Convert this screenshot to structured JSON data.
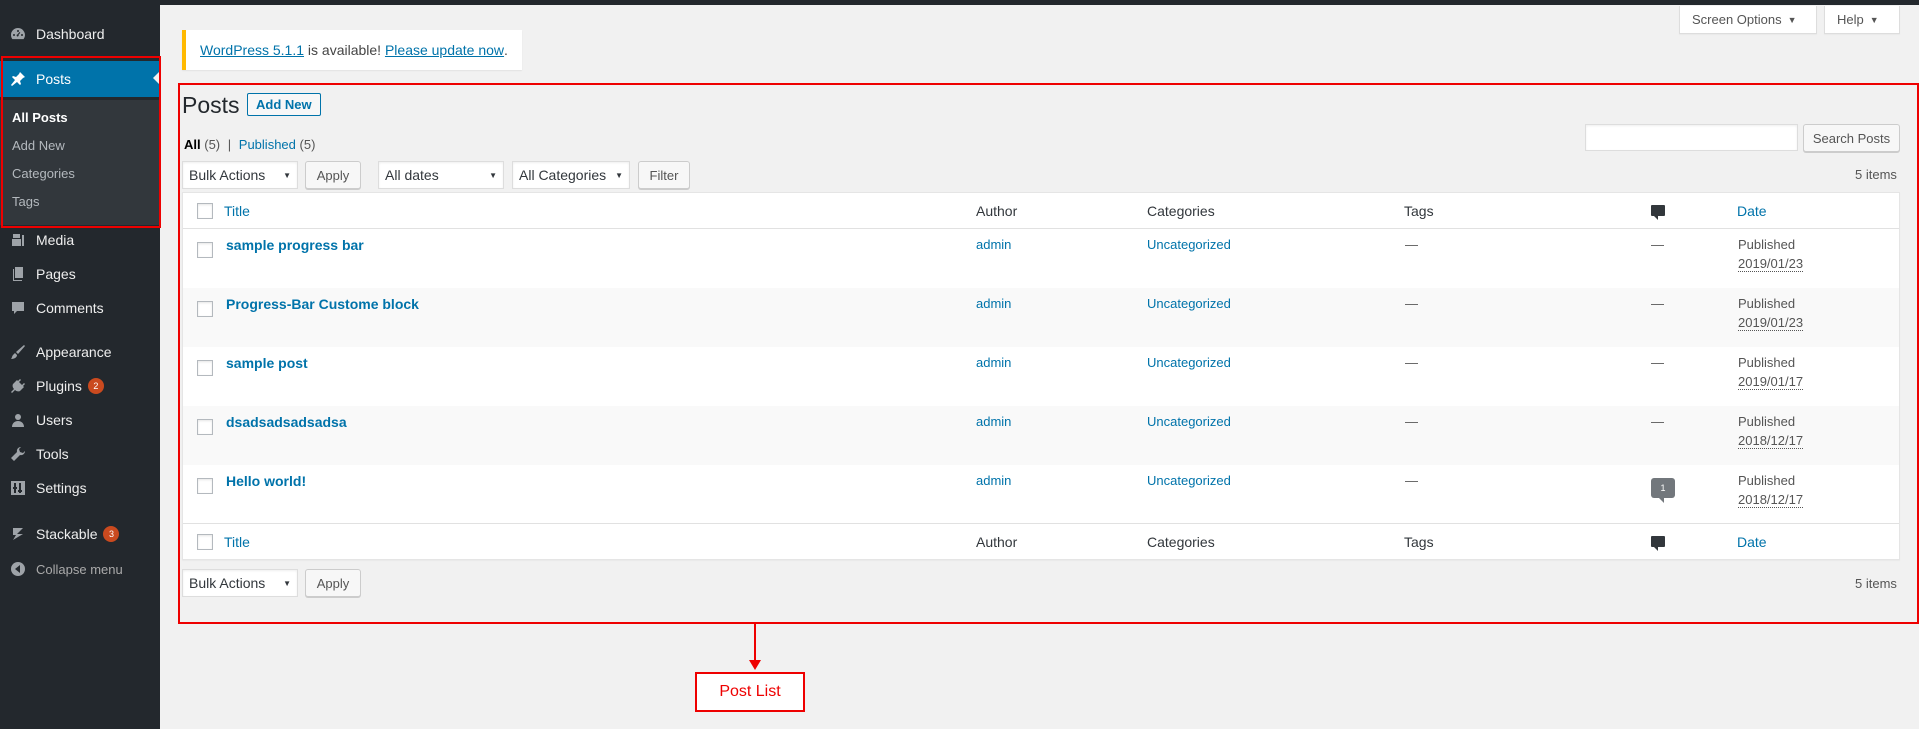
{
  "sidebar": {
    "dashboard": "Dashboard",
    "posts": "Posts",
    "submenu": [
      "All Posts",
      "Add New",
      "Categories",
      "Tags"
    ],
    "media": "Media",
    "pages": "Pages",
    "comments": "Comments",
    "appearance": "Appearance",
    "plugins": "Plugins",
    "plugins_badge": "2",
    "users": "Users",
    "tools": "Tools",
    "settings": "Settings",
    "stackable": "Stackable",
    "stackable_badge": "3",
    "collapse": "Collapse menu"
  },
  "top": {
    "screen_options": "Screen Options",
    "help": "Help"
  },
  "notice": {
    "version_link": "WordPress 5.1.1",
    "text": " is available! ",
    "update_link": "Please update now",
    "end": "."
  },
  "page": {
    "title": "Posts",
    "add_new": "Add New",
    "filter_all": "All",
    "filter_all_count": "(5)",
    "filter_sep": "|",
    "filter_published": "Published",
    "filter_published_count": "(5)",
    "search_button": "Search Posts",
    "bulk_actions": "Bulk Actions",
    "apply": "Apply",
    "all_dates": "All dates",
    "all_categories": "All Categories",
    "filter": "Filter",
    "items_count": "5 items"
  },
  "table": {
    "headers": {
      "title": "Title",
      "author": "Author",
      "categories": "Categories",
      "tags": "Tags",
      "date": "Date"
    },
    "rows": [
      {
        "title": "sample progress bar",
        "author": "admin",
        "categories": "Uncategorized",
        "tags": "—",
        "comments": "—",
        "status": "Published",
        "date": "2019/01/23"
      },
      {
        "title": "Progress-Bar Custome block",
        "author": "admin",
        "categories": "Uncategorized",
        "tags": "—",
        "comments": "—",
        "status": "Published",
        "date": "2019/01/23"
      },
      {
        "title": "sample post",
        "author": "admin",
        "categories": "Uncategorized",
        "tags": "—",
        "comments": "—",
        "status": "Published",
        "date": "2019/01/17"
      },
      {
        "title": "dsadsadsadsadsa",
        "author": "admin",
        "categories": "Uncategorized",
        "tags": "—",
        "comments": "—",
        "status": "Published",
        "date": "2018/12/17"
      },
      {
        "title": "Hello world!",
        "author": "admin",
        "categories": "Uncategorized",
        "tags": "—",
        "comments": "1",
        "status": "Published",
        "date": "2018/12/17"
      }
    ]
  },
  "annotation": {
    "label": "Post List",
    "color": "#e00000"
  },
  "colors": {
    "sidebar_bg": "#23282d",
    "accent": "#0073aa",
    "notice_border": "#ffb900",
    "badge": "#ca4a1f"
  }
}
